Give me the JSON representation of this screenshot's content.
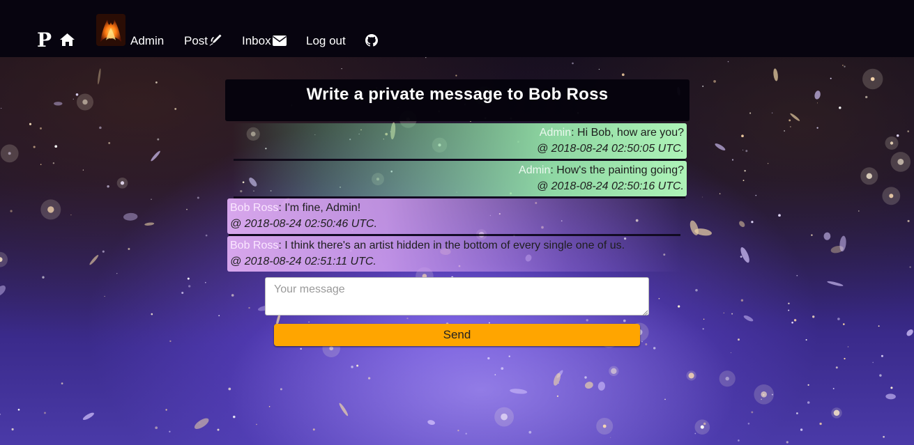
{
  "nav": {
    "brand": "P",
    "admin_label": "Admin",
    "post_label": "Post",
    "inbox_label": "Inbox",
    "logout_label": "Log out",
    "icons": [
      "home-icon",
      "pen-icon",
      "envelope-icon",
      "github-icon"
    ]
  },
  "page": {
    "title": "Write a private message to Bob Ross"
  },
  "messages": [
    {
      "author": "Admin",
      "text": ": Hi Bob, how are you?",
      "timestamp": "@ 2018-08-24 02:50:05 UTC.",
      "direction": "sent"
    },
    {
      "author": "Admin",
      "text": ": How's the painting going?",
      "timestamp": "@ 2018-08-24 02:50:16 UTC.",
      "direction": "sent"
    },
    {
      "author": "Bob Ross",
      "text": ": I'm fine, Admin!",
      "timestamp": "@ 2018-08-24 02:50:46 UTC.",
      "direction": "received"
    },
    {
      "author": "Bob Ross",
      "text": ": I think there's an artist hidden in the bottom of every single one of us.",
      "timestamp": "@ 2018-08-24 02:51:11 UTC.",
      "direction": "received"
    }
  ],
  "form": {
    "placeholder": "Your message",
    "value": "",
    "send_label": "Send"
  },
  "colors": {
    "navbar": "#07040f",
    "sent_bubble": "#aef3b8",
    "received_bubble": "#d7a6ec",
    "send_button": "#ffa500"
  }
}
